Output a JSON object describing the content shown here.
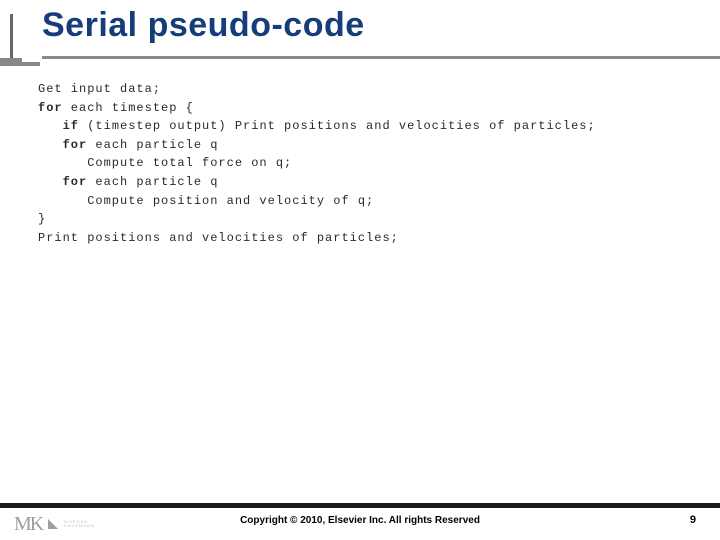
{
  "title": "Serial pseudo-code",
  "colors": {
    "title": "#153d7a",
    "rule": "#8a8a8a",
    "footer_bar": "#1a1a1a",
    "logo": "#9e9e9e"
  },
  "code": {
    "l0_a": "Get input data;",
    "l1_kw": "for",
    "l1_b": " each timestep {",
    "l2_pad": "   ",
    "l2_kw": "if",
    "l2_b": " (timestep output) Print positions and velocities of particles;",
    "l3_pad": "   ",
    "l3_kw": "for",
    "l3_b": " each particle q",
    "l4": "      Compute total force on q;",
    "l5_pad": "   ",
    "l5_kw": "for",
    "l5_b": " each particle q",
    "l6": "      Compute position and velocity of q;",
    "l7": "}",
    "l8": "Print positions and velocities of particles;"
  },
  "logo": {
    "initials": "MK",
    "publisher_line1": "MORGAN",
    "publisher_line2": "KAUFMANN"
  },
  "footer": {
    "copyright": "Copyright © 2010, Elsevier Inc. All rights Reserved",
    "page_number": "9"
  }
}
